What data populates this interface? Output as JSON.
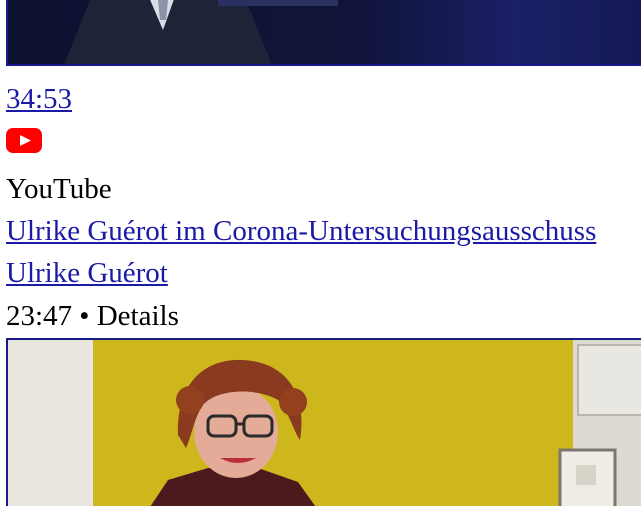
{
  "results": [
    {
      "duration": "34:53"
    },
    {
      "source": {
        "icon": "youtube-icon",
        "name": "YouTube"
      },
      "title": "Ulrike Guérot im Corona-Untersuchungsausschuss",
      "channel": "Ulrike Guérot",
      "meta": "23:47 • Details"
    }
  ],
  "colors": {
    "link": "#1a1aa6",
    "youtube_red": "#ff0000",
    "thumb_border": "#1a1a8a"
  }
}
